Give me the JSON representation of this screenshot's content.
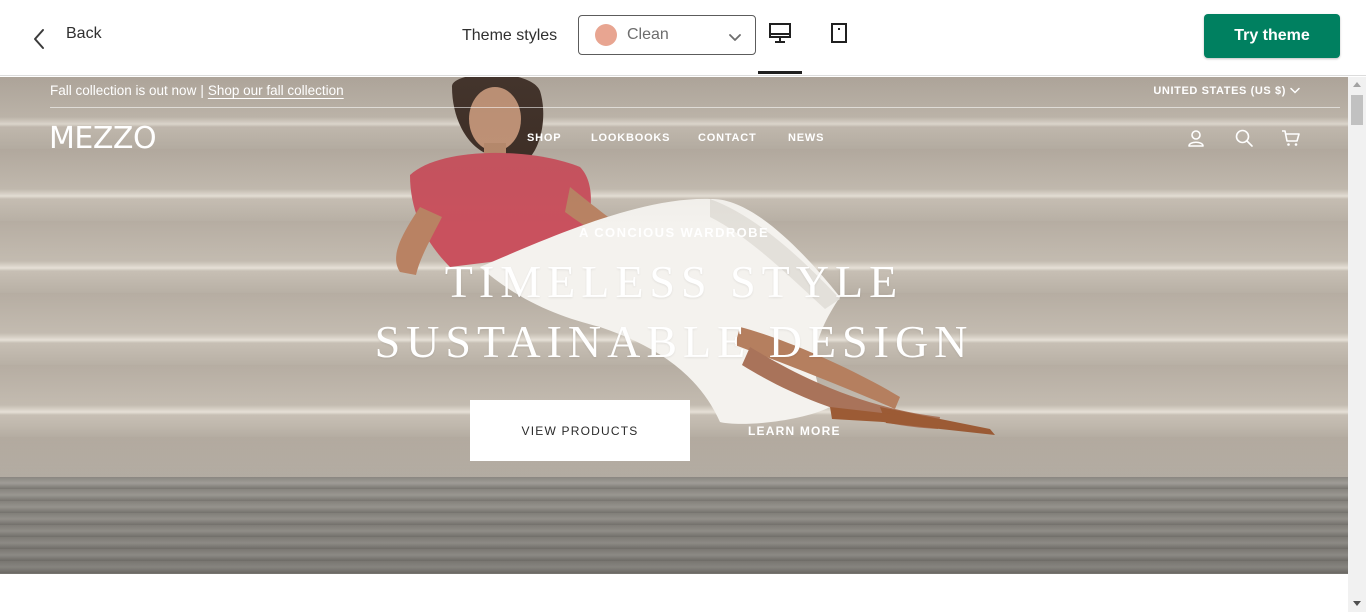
{
  "toolbar": {
    "back_label": "Back",
    "theme_styles_label": "Theme styles",
    "style_select_value": "Clean",
    "style_swatch_color": "#e8a591",
    "try_theme_label": "Try theme",
    "try_theme_color": "#008060"
  },
  "store": {
    "announcement_text": "Fall collection is out now",
    "announcement_separator": "|",
    "announcement_link": "Shop our fall collection",
    "country_selector": "UNITED STATES (US $)",
    "logo": "MEZZO",
    "nav": [
      "SHOP",
      "LOOKBOOKS",
      "CONTACT",
      "NEWS"
    ],
    "icons": [
      "account-icon",
      "search-icon",
      "cart-icon"
    ],
    "hero": {
      "eyebrow": "A CONCIOUS WARDROBE",
      "headline_line1": "TIMELESS STYLE",
      "headline_line2": "SUSTAINABLE DESIGN",
      "primary_button": "VIEW PRODUCTS",
      "secondary_link": "LEARN MORE"
    }
  }
}
